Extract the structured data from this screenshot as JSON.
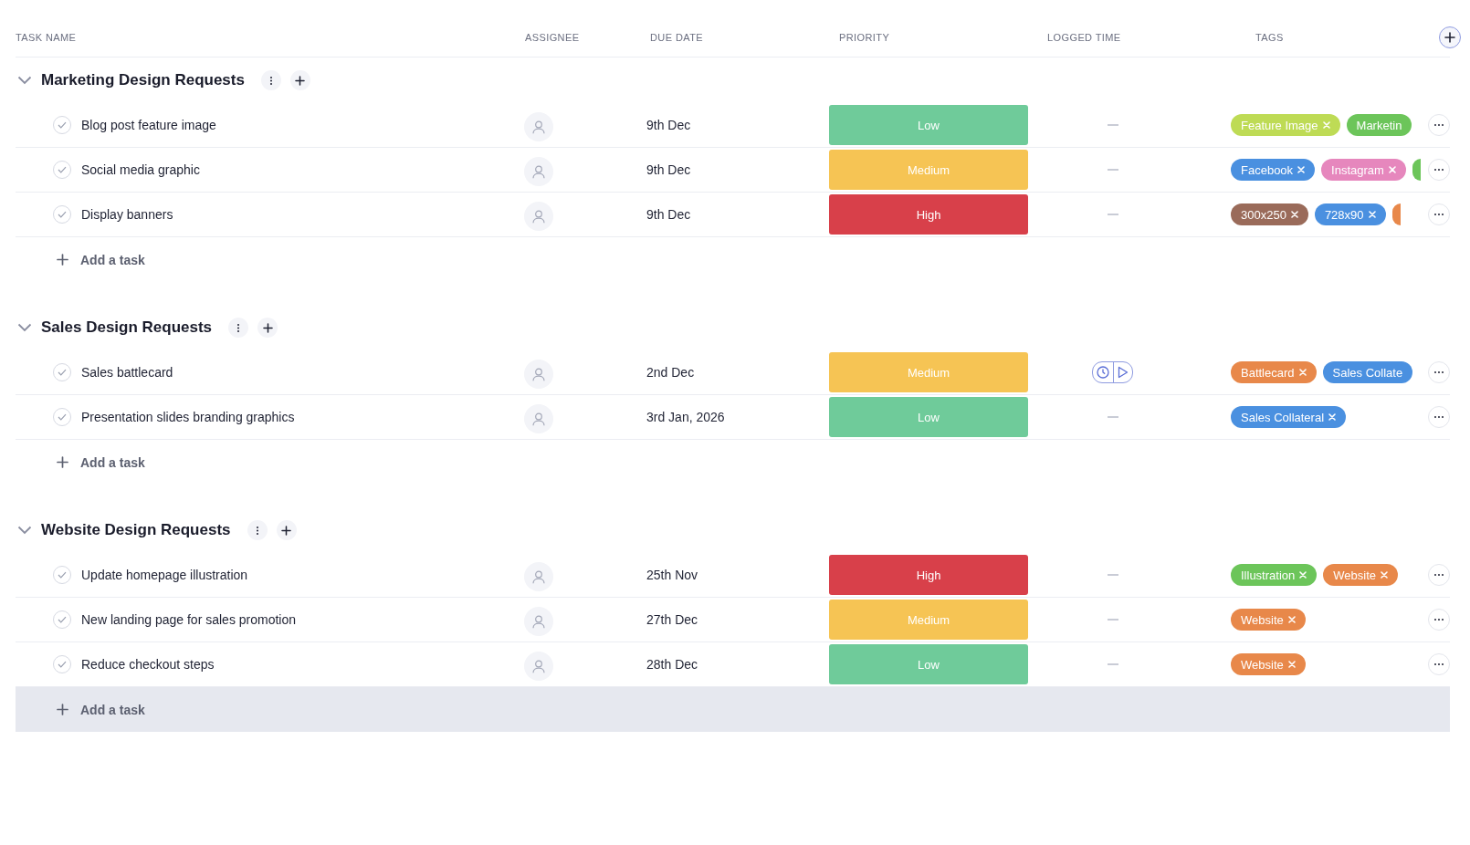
{
  "columns": [
    "TASK NAME",
    "ASSIGNEE",
    "DUE DATE",
    "PRIORITY",
    "LOGGED TIME",
    "TAGS"
  ],
  "groups": [
    {
      "title": "Marketing Design Requests",
      "expanded": true,
      "add_task": {
        "label": "Add a task",
        "highlighted": false
      },
      "tasks": [
        {
          "name": "Blog post feature image",
          "due": "9th Dec",
          "priority": {
            "label": "Low",
            "color": "#6fcb9a"
          },
          "logged": {
            "kind": "empty"
          },
          "tags": [
            {
              "label": "Feature Image",
              "color": "#bedb55",
              "removable": true
            },
            {
              "label": "Marketin",
              "color": "#6cc55a",
              "removable": false
            }
          ]
        },
        {
          "name": "Social media graphic",
          "due": "9th Dec",
          "priority": {
            "label": "Medium",
            "color": "#f6c454"
          },
          "logged": {
            "kind": "empty"
          },
          "tags": [
            {
              "label": "Facebook",
              "color": "#4a90e0",
              "removable": true
            },
            {
              "label": "Instagram",
              "color": "#e687bd",
              "removable": true
            },
            {
              "color": "#6cc55a"
            }
          ]
        },
        {
          "name": "Display banners",
          "due": "9th Dec",
          "priority": {
            "label": "High",
            "color": "#d8404a"
          },
          "logged": {
            "kind": "empty"
          },
          "tags": [
            {
              "label": "300x250",
              "color": "#9a6b5a",
              "removable": true
            },
            {
              "label": "728x90",
              "color": "#4a90e0",
              "removable": true
            },
            {
              "color": "#e8884a"
            }
          ]
        }
      ]
    },
    {
      "title": "Sales Design Requests",
      "expanded": true,
      "add_task": {
        "label": "Add a task",
        "highlighted": false
      },
      "tasks": [
        {
          "name": "Sales battlecard",
          "due": "2nd Dec",
          "priority": {
            "label": "Medium",
            "color": "#f6c454"
          },
          "logged": {
            "kind": "timer"
          },
          "tags": [
            {
              "label": "Battlecard",
              "color": "#e8884a",
              "removable": true
            },
            {
              "label": "Sales Collate",
              "color": "#4a90e0",
              "removable": false
            }
          ]
        },
        {
          "name": "Presentation slides branding graphics",
          "due": "3rd Jan, 2026",
          "priority": {
            "label": "Low",
            "color": "#6fcb9a"
          },
          "logged": {
            "kind": "empty"
          },
          "tags": [
            {
              "label": "Sales Collateral",
              "color": "#4a90e0",
              "removable": true
            }
          ]
        }
      ]
    },
    {
      "title": "Website Design Requests",
      "expanded": true,
      "add_task": {
        "label": "Add a task",
        "highlighted": true
      },
      "tasks": [
        {
          "name": "Update homepage illustration",
          "due": "25th Nov",
          "priority": {
            "label": "High",
            "color": "#d8404a"
          },
          "logged": {
            "kind": "empty"
          },
          "tags": [
            {
              "label": "Illustration",
              "color": "#6cc55a",
              "removable": true
            },
            {
              "label": "Website",
              "color": "#e8884a",
              "removable": true
            }
          ]
        },
        {
          "name": "New landing page for sales promotion",
          "due": "27th Dec",
          "priority": {
            "label": "Medium",
            "color": "#f6c454"
          },
          "logged": {
            "kind": "empty"
          },
          "tags": [
            {
              "label": "Website",
              "color": "#e8884a",
              "removable": true
            }
          ]
        },
        {
          "name": "Reduce checkout steps",
          "due": "28th Dec",
          "priority": {
            "label": "Low",
            "color": "#6fcb9a"
          },
          "logged": {
            "kind": "empty"
          },
          "tags": [
            {
              "label": "Website",
              "color": "#e8884a",
              "removable": true
            }
          ]
        }
      ]
    }
  ]
}
